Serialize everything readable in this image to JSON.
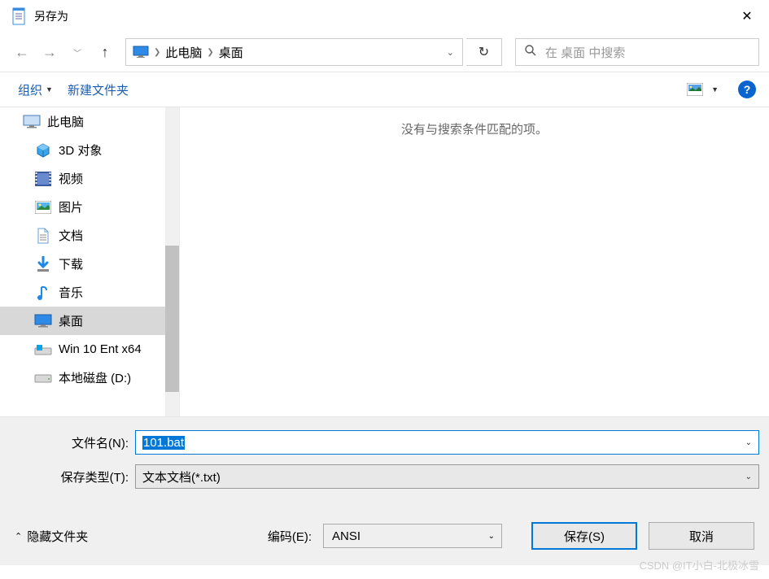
{
  "window": {
    "title": "另存为"
  },
  "breadcrumb": {
    "items": [
      "此电脑",
      "桌面"
    ]
  },
  "search": {
    "placeholder": "在 桌面 中搜索"
  },
  "toolbar": {
    "organize": "组织",
    "new_folder": "新建文件夹"
  },
  "tree": {
    "root": "此电脑",
    "items": [
      {
        "label": "3D 对象",
        "icon": "cube"
      },
      {
        "label": "视频",
        "icon": "film"
      },
      {
        "label": "图片",
        "icon": "picture"
      },
      {
        "label": "文档",
        "icon": "doc"
      },
      {
        "label": "下载",
        "icon": "download"
      },
      {
        "label": "音乐",
        "icon": "music"
      },
      {
        "label": "桌面",
        "icon": "monitor",
        "selected": true
      },
      {
        "label": "Win 10 Ent x64",
        "icon": "drive-win"
      },
      {
        "label": "本地磁盘 (D:)",
        "icon": "drive"
      }
    ]
  },
  "content": {
    "empty_message": "没有与搜索条件匹配的项。"
  },
  "fields": {
    "filename_label": "文件名(N):",
    "filename_value": "101.bat",
    "filetype_label": "保存类型(T):",
    "filetype_value": "文本文档(*.txt)"
  },
  "footer": {
    "hide_folders": "隐藏文件夹",
    "encoding_label": "编码(E):",
    "encoding_value": "ANSI",
    "save": "保存(S)",
    "cancel": "取消"
  },
  "watermark": "CSDN @IT小白-北极冰雪"
}
